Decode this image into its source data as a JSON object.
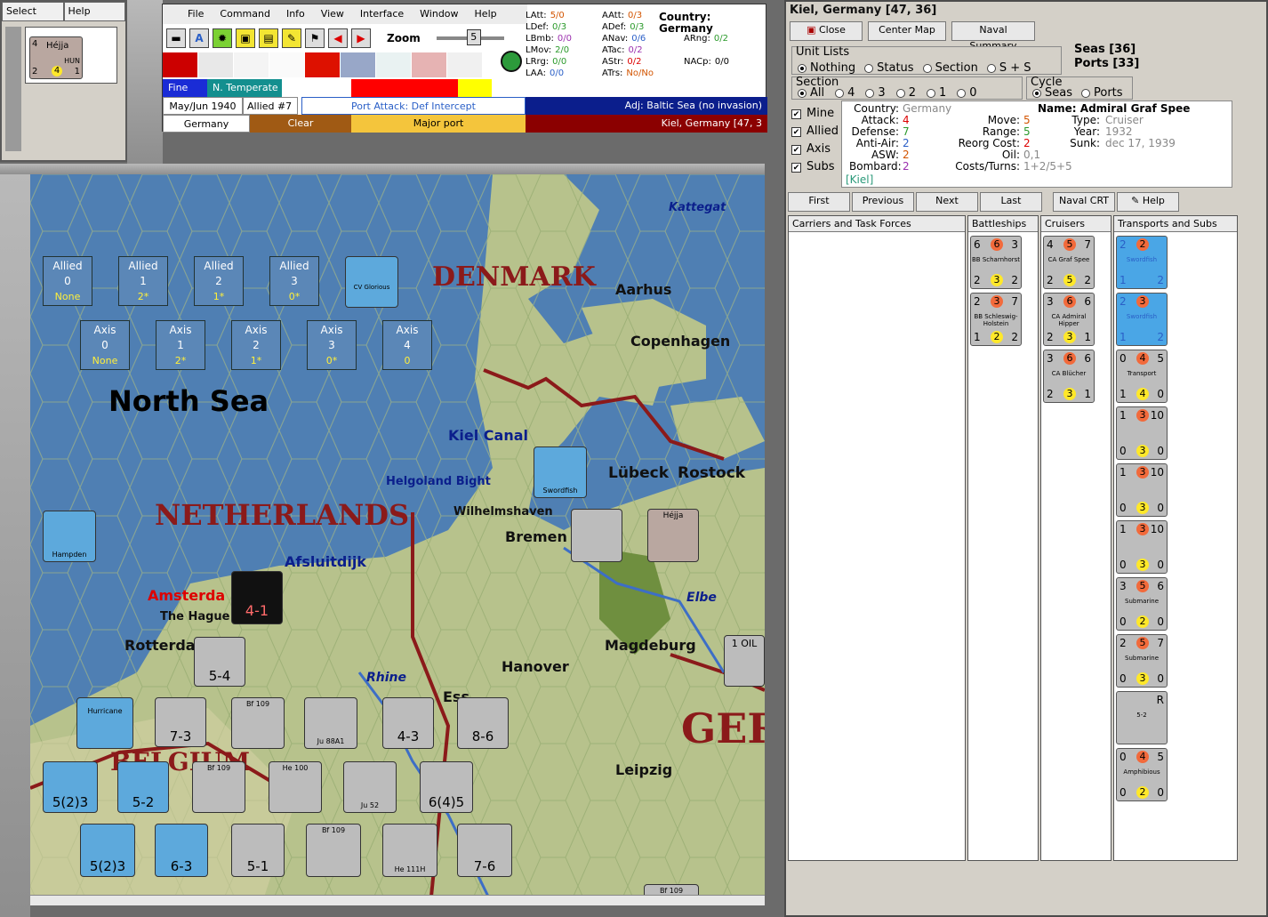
{
  "mini": {
    "select": "Select",
    "help": "Help",
    "card": {
      "tl": "4",
      "name": "Héjja",
      "nat": "HUN",
      "bl": "2",
      "bm": "4",
      "br": "1"
    }
  },
  "menu": [
    "File",
    "Command",
    "Info",
    "View",
    "Interface",
    "Window",
    "Help"
  ],
  "zoom": {
    "label": "Zoom",
    "value": "5"
  },
  "weather": {
    "fine": "Fine",
    "zone": "N. Temperate",
    "date": "May/Jun 1940",
    "allied": "Allied #7",
    "attack": "Port Attack: Def Intercept",
    "country": "Germany",
    "terrain": "Clear",
    "port": "Major port",
    "adj": "Adj: Baltic Sea (no invasion)",
    "loc": "Kiel, Germany [47, 3"
  },
  "stats": {
    "country": "Country: Germany",
    "rows": [
      [
        {
          "k": "LAtt:",
          "v": "5/0",
          "c": "orange"
        },
        {
          "k": "AAtt:",
          "v": "0/3",
          "c": "orange"
        }
      ],
      [
        {
          "k": "LDef:",
          "v": "0/3",
          "c": "green"
        },
        {
          "k": "ADef:",
          "v": "0/3",
          "c": "green"
        }
      ],
      [
        {
          "k": "LBmb:",
          "v": "0/0",
          "c": "purple"
        },
        {
          "k": "ANav:",
          "v": "0/6",
          "c": "blue"
        },
        {
          "k": "ARng:",
          "v": "0/2",
          "c": "green"
        }
      ],
      [
        {
          "k": "LMov:",
          "v": "2/0",
          "c": "green"
        },
        {
          "k": "ATac:",
          "v": "0/2",
          "c": "purple"
        }
      ],
      [
        {
          "k": "LRrg:",
          "v": "0/0",
          "c": "green"
        },
        {
          "k": "AStr:",
          "v": "0/2",
          "c": "red"
        },
        {
          "k": "NACp:",
          "v": "0/0",
          "c": ""
        }
      ],
      [
        {
          "k": "LAA:",
          "v": "0/0",
          "c": "blue"
        },
        {
          "k": "ATrs:",
          "v": "No/No",
          "c": "orange"
        }
      ]
    ]
  },
  "map": {
    "labels": {
      "denmark": "DENMARK",
      "aarhus": "Aarhus",
      "copenhagen": "Copenhagen",
      "kattegat": "Kattegat",
      "northsea": "North Sea",
      "kiel": "Kiel Canal",
      "helgoland": "Helgoland Bight",
      "netherlands": "NETHERLANDS",
      "wilhelmshaven": "Wilhelmshaven",
      "bremen": "Bremen",
      "lubeck": "Lübeck",
      "rostock": "Rostock",
      "afsluitdijk": "Afsluitdijk",
      "amsterdam": "Amsterda",
      "hague": "The Hague",
      "rotterdam": "Rotterda",
      "hanover": "Hanover",
      "magdeburg": "Magdeburg",
      "elbe": "Elbe",
      "rhine": "Rhine",
      "leipzig": "Leipzig",
      "germany": "GER",
      "belgium": "BELGIUM",
      "essen": "Ess",
      "oil": "1 OIL"
    },
    "zones": [
      {
        "side": "Allied",
        "n": "0",
        "v": "None"
      },
      {
        "side": "Allied",
        "n": "1",
        "v": "2*"
      },
      {
        "side": "Allied",
        "n": "2",
        "v": "1*"
      },
      {
        "side": "Allied",
        "n": "3",
        "v": "0*"
      },
      {
        "side": "Axis",
        "n": "0",
        "v": "None"
      },
      {
        "side": "Axis",
        "n": "1",
        "v": "2*"
      },
      {
        "side": "Axis",
        "n": "2",
        "v": "1*"
      },
      {
        "side": "Axis",
        "n": "3",
        "v": "0*"
      },
      {
        "side": "Axis",
        "n": "4",
        "v": "0"
      }
    ],
    "counters": {
      "glorious": "CV Glorious",
      "swordfish": "Swordfish",
      "hampden": "Hampden",
      "hejja": "Héjja",
      "redunit": "4-1",
      "u1": "5-4",
      "u2": "7-3",
      "u3": "4-3",
      "u4": "8-6",
      "u5": "5-2",
      "u6": "5(2)3",
      "u7": "6(4)5",
      "u8": "6-3",
      "u9": "5-1",
      "u10": "7-6",
      "bf109a": "Bf 109",
      "ju88": "Ju 88A1",
      "he100": "He 100",
      "ju52": "Ju 52",
      "he111": "He 111H",
      "hurricane": "Hurricane"
    }
  },
  "right": {
    "title": "Kiel, Germany [47, 36]",
    "close": "Close",
    "center": "Center Map",
    "summary": "Naval Summary",
    "unitlists": "Unit Lists",
    "ul_opts": [
      "Nothing",
      "Status",
      "Section",
      "S + S"
    ],
    "seas": "Seas [36]",
    "ports": "Ports [33]",
    "section": "Section",
    "sec_opts": [
      "All",
      "4",
      "3",
      "2",
      "1",
      "0"
    ],
    "cycle": "Cycle",
    "cyc_opts": [
      "Seas",
      "Ports"
    ],
    "checks": [
      "Mine",
      "Allied",
      "Axis",
      "Subs"
    ],
    "info": {
      "country_k": "Country:",
      "country_v": "Germany",
      "attack_k": "Attack:",
      "attack_v": "4",
      "defense_k": "Defense:",
      "defense_v": "7",
      "aa_k": "Anti-Air:",
      "aa_v": "2",
      "asw_k": "ASW:",
      "asw_v": "2",
      "bomb_k": "Bombard:",
      "bomb_v": "2",
      "loc": "[Kiel]",
      "move_k": "Move:",
      "move_v": "5",
      "range_k": "Range:",
      "range_v": "5",
      "reorg_k": "Reorg Cost:",
      "reorg_v": "2",
      "oil_k": "Oil:",
      "oil_v": "0,1",
      "costs_k": "Costs/Turns:",
      "costs_v": "1+2/5+5",
      "name_k": "Name:",
      "name_v": "Admiral Graf Spee",
      "type_k": "Type:",
      "type_v": "Cruiser",
      "year_k": "Year:",
      "year_v": "1932",
      "sunk_k": "Sunk:",
      "sunk_v": "dec 17, 1939"
    },
    "nav": [
      "First",
      "Previous",
      "Next",
      "Last"
    ],
    "crt": "Naval CRT",
    "help": "Help",
    "cols": [
      "Carriers and Task Forces",
      "Battleships",
      "Cruisers",
      "Transports and Subs"
    ],
    "battleships": [
      {
        "tl": "6",
        "tm": "6",
        "tr": "3",
        "nm": "BB Scharnhorst",
        "bl": "2",
        "bm": "3",
        "br": "2"
      },
      {
        "tl": "2",
        "tm": "3",
        "tr": "7",
        "nm": "BB Schleswig-Holstein",
        "bl": "1",
        "bm": "2",
        "br": "2"
      }
    ],
    "cruisers": [
      {
        "tl": "4",
        "tm": "5",
        "tr": "7",
        "nm": "CA Graf Spee",
        "bl": "2",
        "bm": "5",
        "br": "2"
      },
      {
        "tl": "3",
        "tm": "6",
        "tr": "6",
        "nm": "CA Admiral Hipper",
        "bl": "2",
        "bm": "3",
        "br": "1"
      },
      {
        "tl": "3",
        "tm": "6",
        "tr": "6",
        "nm": "CA Blücher",
        "bl": "2",
        "bm": "3",
        "br": "1"
      }
    ],
    "transports": [
      {
        "tl": "2",
        "tm": "2",
        "tr": "",
        "nm": "Swordfish",
        "bl": "1",
        "bm": "",
        "br": "2",
        "blue": true
      },
      {
        "tl": "2",
        "tm": "3",
        "tr": "",
        "nm": "Swordfish",
        "bl": "1",
        "bm": "",
        "br": "2",
        "blue": true
      },
      {
        "tl": "0",
        "tm": "4",
        "tr": "5",
        "nm": "Transport",
        "bl": "1",
        "bm": "4",
        "br": "0"
      },
      {
        "tl": "1",
        "tm": "3",
        "tr": "10",
        "nm": "",
        "bl": "0",
        "bm": "3",
        "br": "0"
      },
      {
        "tl": "1",
        "tm": "3",
        "tr": "10",
        "nm": "",
        "bl": "0",
        "bm": "3",
        "br": "0"
      },
      {
        "tl": "1",
        "tm": "3",
        "tr": "10",
        "nm": "",
        "bl": "0",
        "bm": "3",
        "br": "0"
      },
      {
        "tl": "3",
        "tm": "5",
        "tr": "6",
        "nm": "Submarine",
        "bl": "0",
        "bm": "2",
        "br": "0"
      },
      {
        "tl": "2",
        "tm": "5",
        "tr": "7",
        "nm": "Submarine",
        "bl": "0",
        "bm": "3",
        "br": "0"
      },
      {
        "tl": "",
        "tm": "",
        "tr": "R",
        "nm": "5-2",
        "bl": "",
        "bm": "",
        "br": ""
      },
      {
        "tl": "0",
        "tm": "4",
        "tr": "5",
        "nm": "Amphibious",
        "bl": "0",
        "bm": "2",
        "br": "0"
      }
    ]
  }
}
